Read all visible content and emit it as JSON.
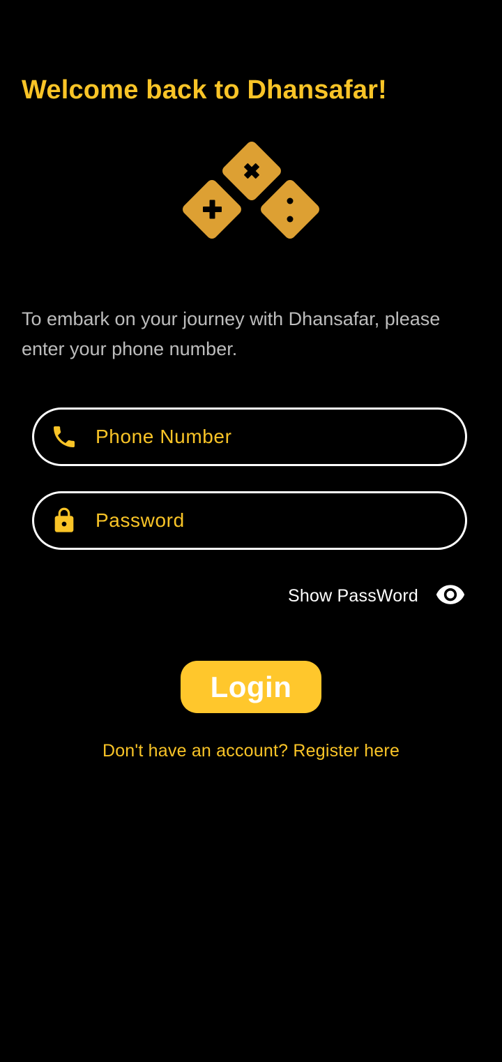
{
  "header": {
    "title": "Welcome back to Dhansafar!"
  },
  "logo": {
    "icon": "math-operators-diamonds-icon",
    "color": "#DDA033",
    "symbols": [
      "×",
      "+",
      "÷"
    ]
  },
  "intro": {
    "text": "To embark on your journey with Dhansafar, please enter your phone number."
  },
  "form": {
    "phone": {
      "icon": "phone-icon",
      "placeholder": "Phone Number",
      "value": ""
    },
    "password": {
      "icon": "lock-icon",
      "placeholder": "Password",
      "value": ""
    },
    "show_password": {
      "label": "Show PassWord",
      "icon": "eye-icon"
    },
    "login_label": "Login",
    "register_link": "Don't have an account? Register here"
  },
  "colors": {
    "background": "#000000",
    "accent": "#F9C427",
    "button": "#FFC72C",
    "logo": "#DDA033",
    "body_text": "#BDBDBD",
    "border": "#FFFFFF"
  }
}
